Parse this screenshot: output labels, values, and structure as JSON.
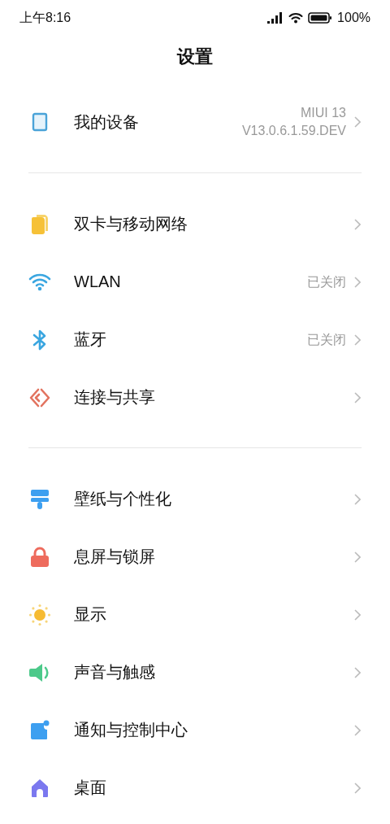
{
  "status_bar": {
    "time": "上午8:16",
    "battery_text": "100%"
  },
  "title": "设置",
  "sections": [
    {
      "items": [
        {
          "label": "我的设备",
          "value_lines": [
            "MIUI 13",
            "V13.0.6.1.59.DEV"
          ]
        }
      ]
    },
    {
      "items": [
        {
          "label": "双卡与移动网络"
        },
        {
          "label": "WLAN",
          "value_lines": [
            "已关闭"
          ]
        },
        {
          "label": "蓝牙",
          "value_lines": [
            "已关闭"
          ]
        },
        {
          "label": "连接与共享"
        }
      ]
    },
    {
      "items": [
        {
          "label": "壁纸与个性化"
        },
        {
          "label": "息屏与锁屏"
        },
        {
          "label": "显示"
        },
        {
          "label": "声音与触感"
        },
        {
          "label": "通知与控制中心"
        },
        {
          "label": "桌面"
        }
      ]
    }
  ]
}
